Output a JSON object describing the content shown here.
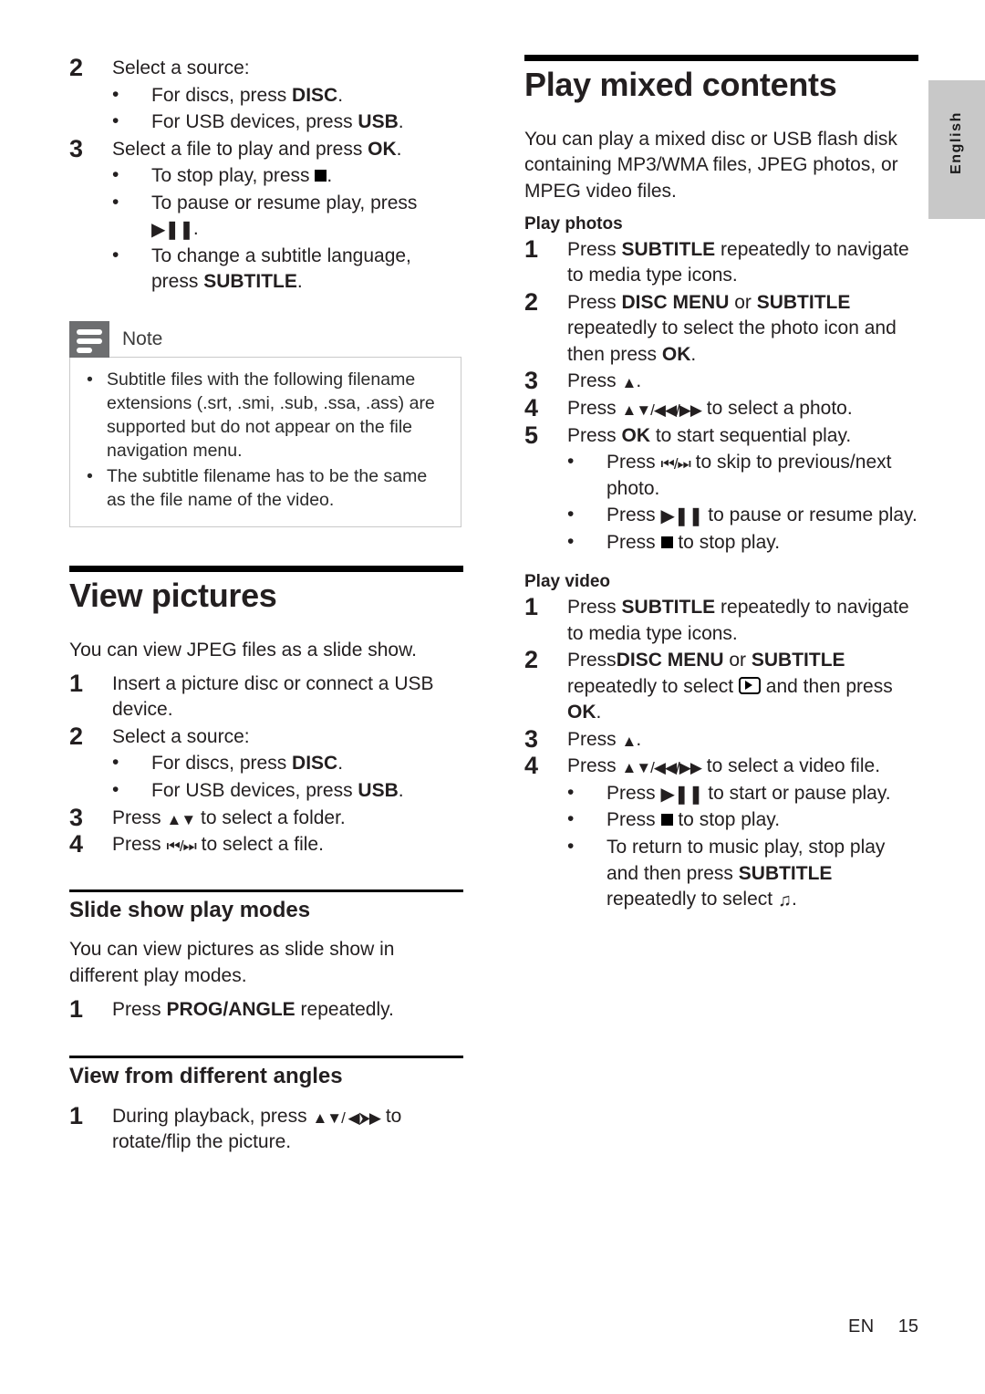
{
  "page": {
    "language_tab": "English",
    "footer": {
      "locale": "EN",
      "page_number": "15"
    }
  },
  "left_column": {
    "continued_steps": [
      {
        "num": "2",
        "text": "Select a source:",
        "bullets": [
          {
            "pre": "For discs, press ",
            "bold": "DISC",
            "post": "."
          },
          {
            "pre": "For USB devices, press ",
            "bold": "USB",
            "post": "."
          }
        ]
      },
      {
        "num": "3",
        "pre": "Select a file to play and press ",
        "bold": "OK",
        "post": ".",
        "bullets": [
          {
            "pre": "To stop play, press ",
            "icon": "stop-icon",
            "post": "."
          },
          {
            "pre": "To pause or resume play, press ",
            "icon": "play-pause-icon",
            "post": "."
          },
          {
            "pre": "To change a subtitle language, press ",
            "bold": "SUBTITLE",
            "post": "."
          }
        ]
      }
    ],
    "note": {
      "icon": "note-lines-icon",
      "title": "Note",
      "items": [
        "Subtitle files with the following filename extensions (.srt, .smi, .sub, .ssa, .ass) are supported but do not appear on the file navigation menu.",
        "The subtitle filename has to be the same as the file name of the video."
      ]
    },
    "view_pictures": {
      "heading": "View pictures",
      "intro": "You can view JPEG files as a slide show.",
      "steps": [
        {
          "num": "1",
          "text": "Insert a picture disc or connect a USB device."
        },
        {
          "num": "2",
          "text": "Select a source:",
          "bullets": [
            {
              "pre": "For discs, press ",
              "bold": "DISC",
              "post": "."
            },
            {
              "pre": "For USB devices, press ",
              "bold": "USB",
              "post": "."
            }
          ]
        },
        {
          "num": "3",
          "pre": "Press ",
          "icon": "up-down-arrows-icon",
          "post": " to select a folder."
        },
        {
          "num": "4",
          "pre": "Press ",
          "icon": "prev-next-icon",
          "post": " to select a file."
        }
      ]
    },
    "slide_show_play_modes": {
      "heading": "Slide show play modes",
      "intro": "You can view pictures as slide show in different play modes.",
      "steps": [
        {
          "num": "1",
          "pre": "Press ",
          "bold": "PROG/ANGLE",
          "post": " repeatedly."
        }
      ]
    },
    "view_from_different_angles": {
      "heading": "View from different angles",
      "steps": [
        {
          "num": "1",
          "pre": "During playback, press ",
          "icon": "up-down-left-right-icon",
          "post": " to rotate/flip the picture."
        }
      ]
    }
  },
  "right_column": {
    "heading": "Play mixed contents",
    "intro": "You can play a mixed disc or USB flash disk containing MP3/WMA files, JPEG photos, or MPEG video files.",
    "play_photos": {
      "heading": "Play photos",
      "steps": [
        {
          "num": "1",
          "pre": "Press ",
          "bold": "SUBTITLE",
          "post": " repeatedly to navigate to media type icons."
        },
        {
          "num": "2",
          "pre": "Press ",
          "bold": "DISC MENU",
          "mid": " or ",
          "bold2": "SUBTITLE",
          "post": " repeatedly to select the photo icon and then press ",
          "bold3": "OK",
          "post2": "."
        },
        {
          "num": "3",
          "pre": "Press ",
          "icon": "up-arrow-icon",
          "post": "."
        },
        {
          "num": "4",
          "pre": "Press ",
          "icon": "nav-arrows-icon",
          "post": " to select a photo."
        },
        {
          "num": "5",
          "pre": "Press ",
          "bold": "OK",
          "post": " to start sequential play.",
          "bullets": [
            {
              "pre": "Press ",
              "icon": "prev-next-icon",
              "post": " to skip to previous/next photo."
            },
            {
              "pre": "Press ",
              "icon": "play-pause-icon",
              "post": " to pause or resume play."
            },
            {
              "pre": "Press ",
              "icon": "stop-icon",
              "post": " to stop play."
            }
          ]
        }
      ]
    },
    "play_video": {
      "heading": "Play video",
      "steps": [
        {
          "num": "1",
          "pre": "Press ",
          "bold": "SUBTITLE",
          "post": " repeatedly to navigate to media type icons."
        },
        {
          "num": "2",
          "pre": "Press",
          "bold": "DISC MENU",
          "mid": " or ",
          "bold2": "SUBTITLE",
          "post": " repeatedly to select ",
          "icon": "video-icon",
          "post2": " and then press ",
          "bold3": "OK",
          "post3": "."
        },
        {
          "num": "3",
          "pre": "Press ",
          "icon": "up-arrow-icon",
          "post": "."
        },
        {
          "num": "4",
          "pre": "Press ",
          "icon": "nav-arrows-icon",
          "post": " to select a video file.",
          "bullets": [
            {
              "pre": "Press ",
              "icon": "play-pause-icon",
              "post": " to start or pause play."
            },
            {
              "pre": "Press ",
              "icon": "stop-icon",
              "post": " to stop play."
            },
            {
              "pre": "To return to music play, stop play and then press ",
              "bold": "SUBTITLE",
              "post": " repeatedly to select ",
              "icon": "music-note-icon",
              "post2": "."
            }
          ]
        }
      ]
    }
  }
}
